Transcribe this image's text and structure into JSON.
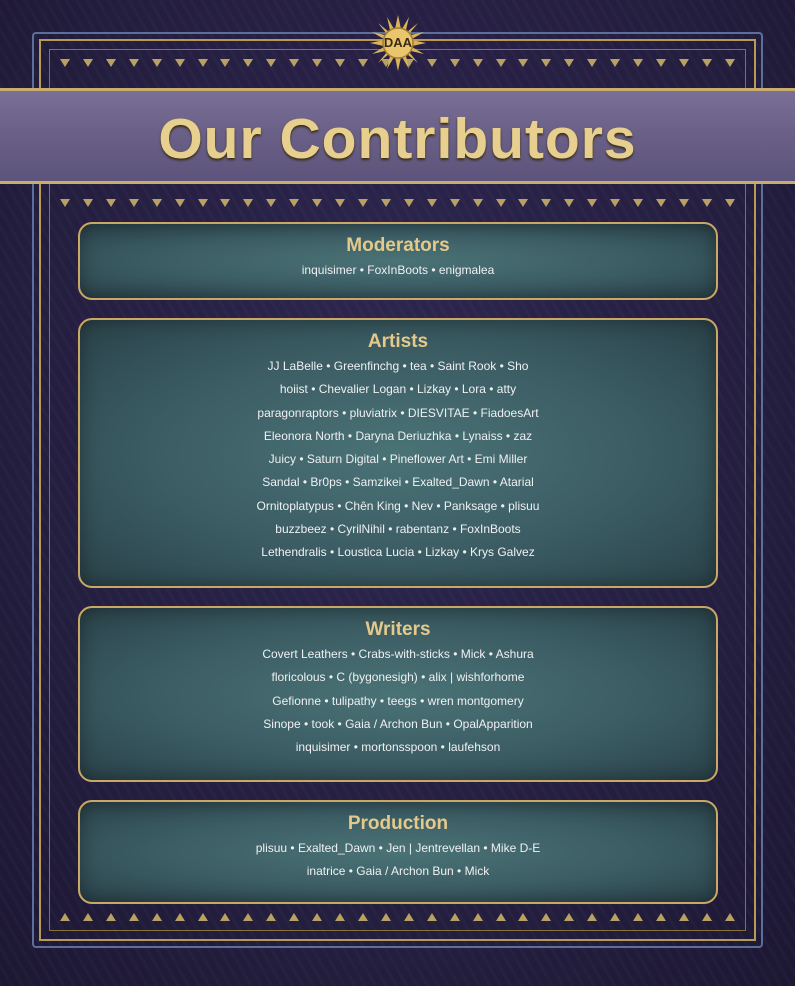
{
  "header": {
    "logo_text": "DAA",
    "title": "Our Contributors"
  },
  "sections": {
    "moderators": {
      "title": "Moderators",
      "lines": [
        "inquisimer • FoxInBoots • enigmalea"
      ]
    },
    "artists": {
      "title": "Artists",
      "lines": [
        "JJ LaBelle • Greenfinchg • tea • Saint Rook • Sho",
        "hoiist • Chevalier Logan • Lizkay • Lora • atty",
        "paragonraptors • pluviatrix • DIESVITAE • FiadoesArt",
        "Eleonora North • Daryna Deriuzhka • Lynaiss • zaz",
        "Juicy • Saturn Digital • Pineflower Art • Emi Miller",
        "Sandal • Br0ps • Samzikei • Exalted_Dawn • Atarial",
        "Ornitoplatypus • Chên King • Nev • Panksage • plisuu",
        "buzzbeez • CyrilNihil • rabentanz • FoxInBoots",
        "Lethendralis • Loustica Lucia • Lizkay • Krys Galvez"
      ]
    },
    "writers": {
      "title": "Writers",
      "lines": [
        "Covert Leathers • Crabs-with-sticks • Mick • Ashura",
        "floricolous • C (bygonesigh) • alix | wishforhome",
        "Gefionne • tulipathy • teegs • wren montgomery",
        "Sinope • took • Gaia / Archon Bun • OpalApparition",
        "inquisimer • mortonsspoon • laufehson"
      ]
    },
    "production": {
      "title": "Production",
      "lines": [
        "plisuu • Exalted_Dawn • Jen | Jentrevellan • Mike D-E",
        "inatrice • Gaia / Archon Bun • Mick"
      ]
    }
  },
  "colors": {
    "background": "#221c3a",
    "gold": "#c9a865",
    "banner": "#6a6088",
    "panel": "#3b5c63",
    "text": "#f0f0f2"
  }
}
